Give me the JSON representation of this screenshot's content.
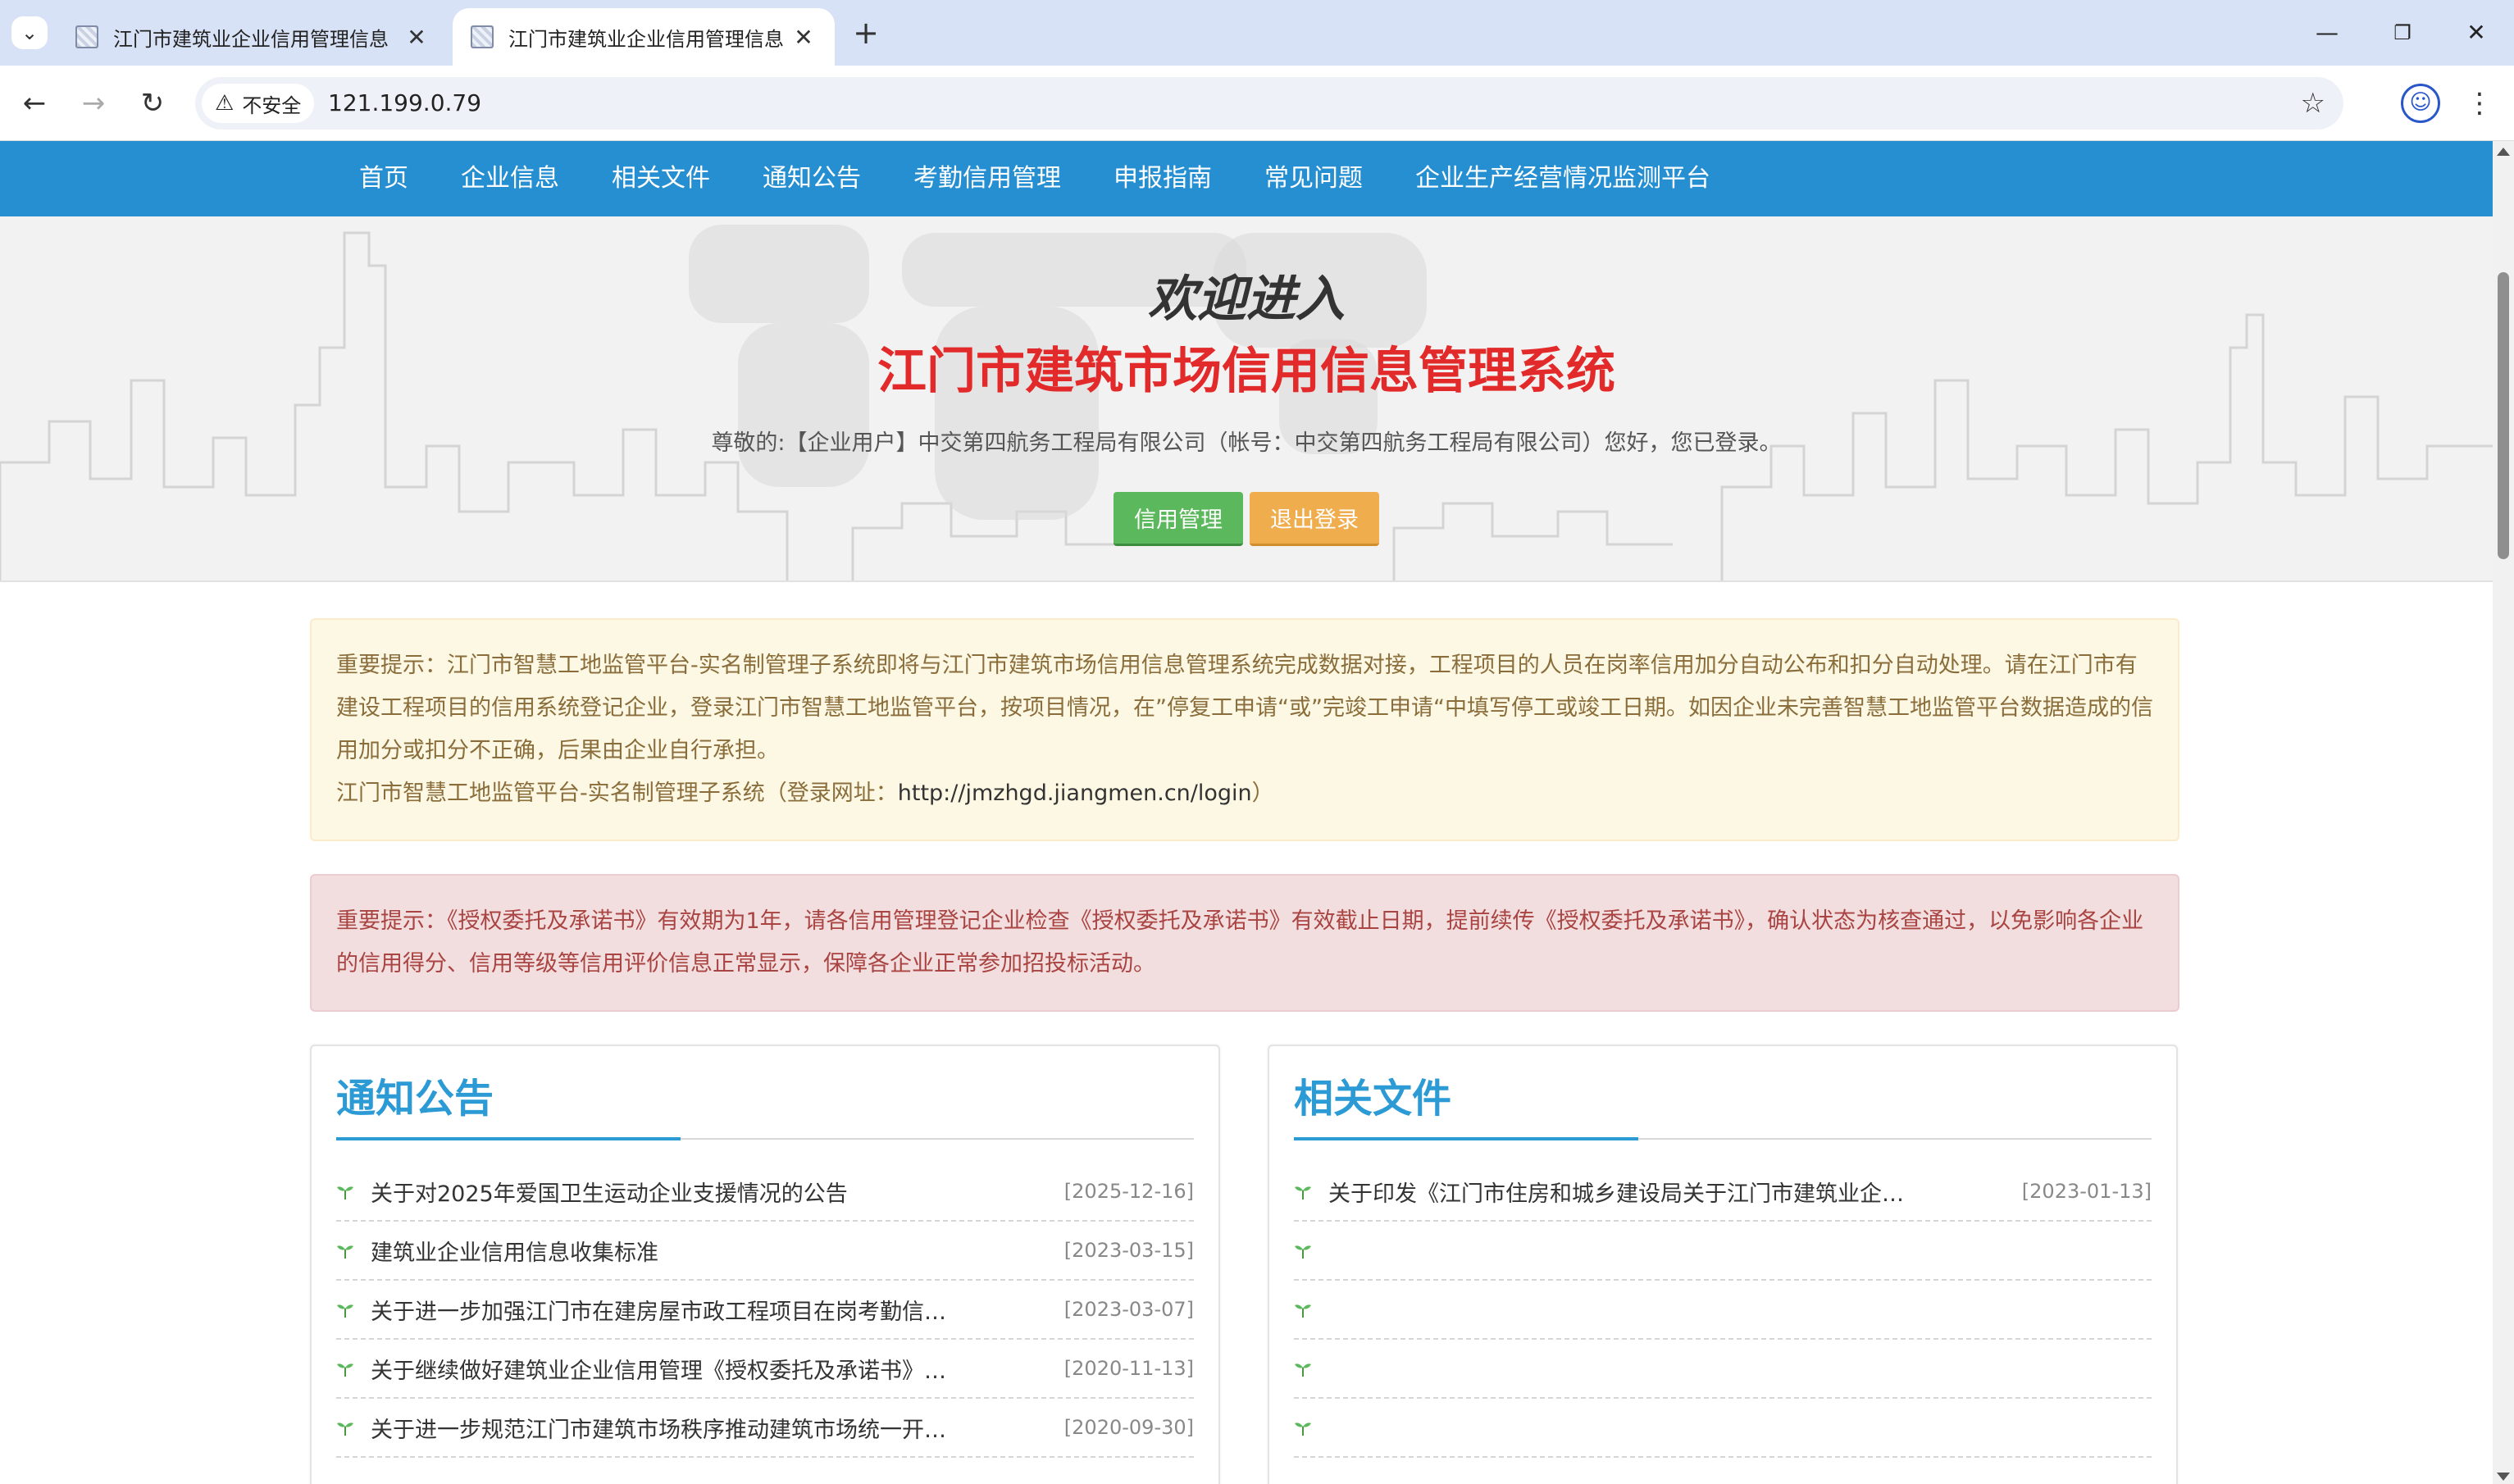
{
  "browser": {
    "tabs": [
      {
        "title": "江门市建筑业企业信用管理信息",
        "active": false
      },
      {
        "title": "江门市建筑业企业信用管理信息",
        "active": true
      }
    ],
    "security_label": "不安全",
    "url": "121.199.0.79"
  },
  "site_nav": {
    "items": [
      "首页",
      "企业信息",
      "相关文件",
      "通知公告",
      "考勤信用管理",
      "申报指南",
      "常见问题",
      "企业生产经营情况监测平台"
    ]
  },
  "hero": {
    "welcome": "欢迎进入",
    "system_title": "江门市建筑市场信用信息管理系统",
    "greeting": "尊敬的:【企业用户】中交第四航务工程局有限公司（帐号：中交第四航务工程局有限公司）您好，您已登录。",
    "credit_button": "信用管理",
    "logout_button": "退出登录",
    "colors": {
      "credit": "#5cb85c",
      "logout": "#f0ad4e",
      "title": "#e32a2a"
    }
  },
  "notices": {
    "warning_line1": "重要提示：江门市智慧工地监管平台-实名制管理子系统即将与江门市建筑市场信用信息管理系统完成数据对接，工程项目的人员在岗率信用加分自动公布和扣分自动处理。请在江门市有建设工程项目的信用系统登记企业，登录江门市智慧工地监管平台，按项目情况，在”停复工申请“或”完竣工申请“中填写停工或竣工日期。如因企业未完善智慧工地监管平台数据造成的信用加分或扣分不正确，后果由企业自行承担。",
    "warning_line2_prefix": "江门市智慧工地监管平台-实名制管理子系统（登录网址：",
    "warning_link": "http://jmzhgd.jiangmen.cn/login",
    "warning_line2_suffix": "）",
    "danger_text": "重要提示：《授权委托及承诺书》有效期为1年，请各信用管理登记企业检查《授权委托及承诺书》有效截止日期，提前续传《授权委托及承诺书》，确认状态为核查通过，以免影响各企业的信用得分、信用等级等信用评价信息正常显示，保障各企业正常参加招投标活动。"
  },
  "panels": {
    "announcements": {
      "title": "通知公告",
      "items": [
        {
          "title": "关于对2025年爱国卫生运动企业支援情况的公告",
          "date": "[2025-12-16]"
        },
        {
          "title": "建筑业企业信用信息收集标准",
          "date": "[2023-03-15]"
        },
        {
          "title": "关于进一步加强江门市在建房屋市政工程项目在岗考勤信…",
          "date": "[2023-03-07]"
        },
        {
          "title": "关于继续做好建筑业企业信用管理《授权委托及承诺书》…",
          "date": "[2020-11-13]"
        },
        {
          "title": "关于进一步规范江门市建筑市场秩序推动建筑市场统一开…",
          "date": "[2020-09-30]"
        }
      ]
    },
    "documents": {
      "title": "相关文件",
      "items": [
        {
          "title": "关于印发《江门市住房和城乡建设局关于江门市建筑业企…",
          "date": "[2023-01-13]"
        },
        {
          "title": "",
          "date": ""
        },
        {
          "title": "",
          "date": ""
        },
        {
          "title": "",
          "date": ""
        },
        {
          "title": "",
          "date": ""
        }
      ]
    }
  }
}
